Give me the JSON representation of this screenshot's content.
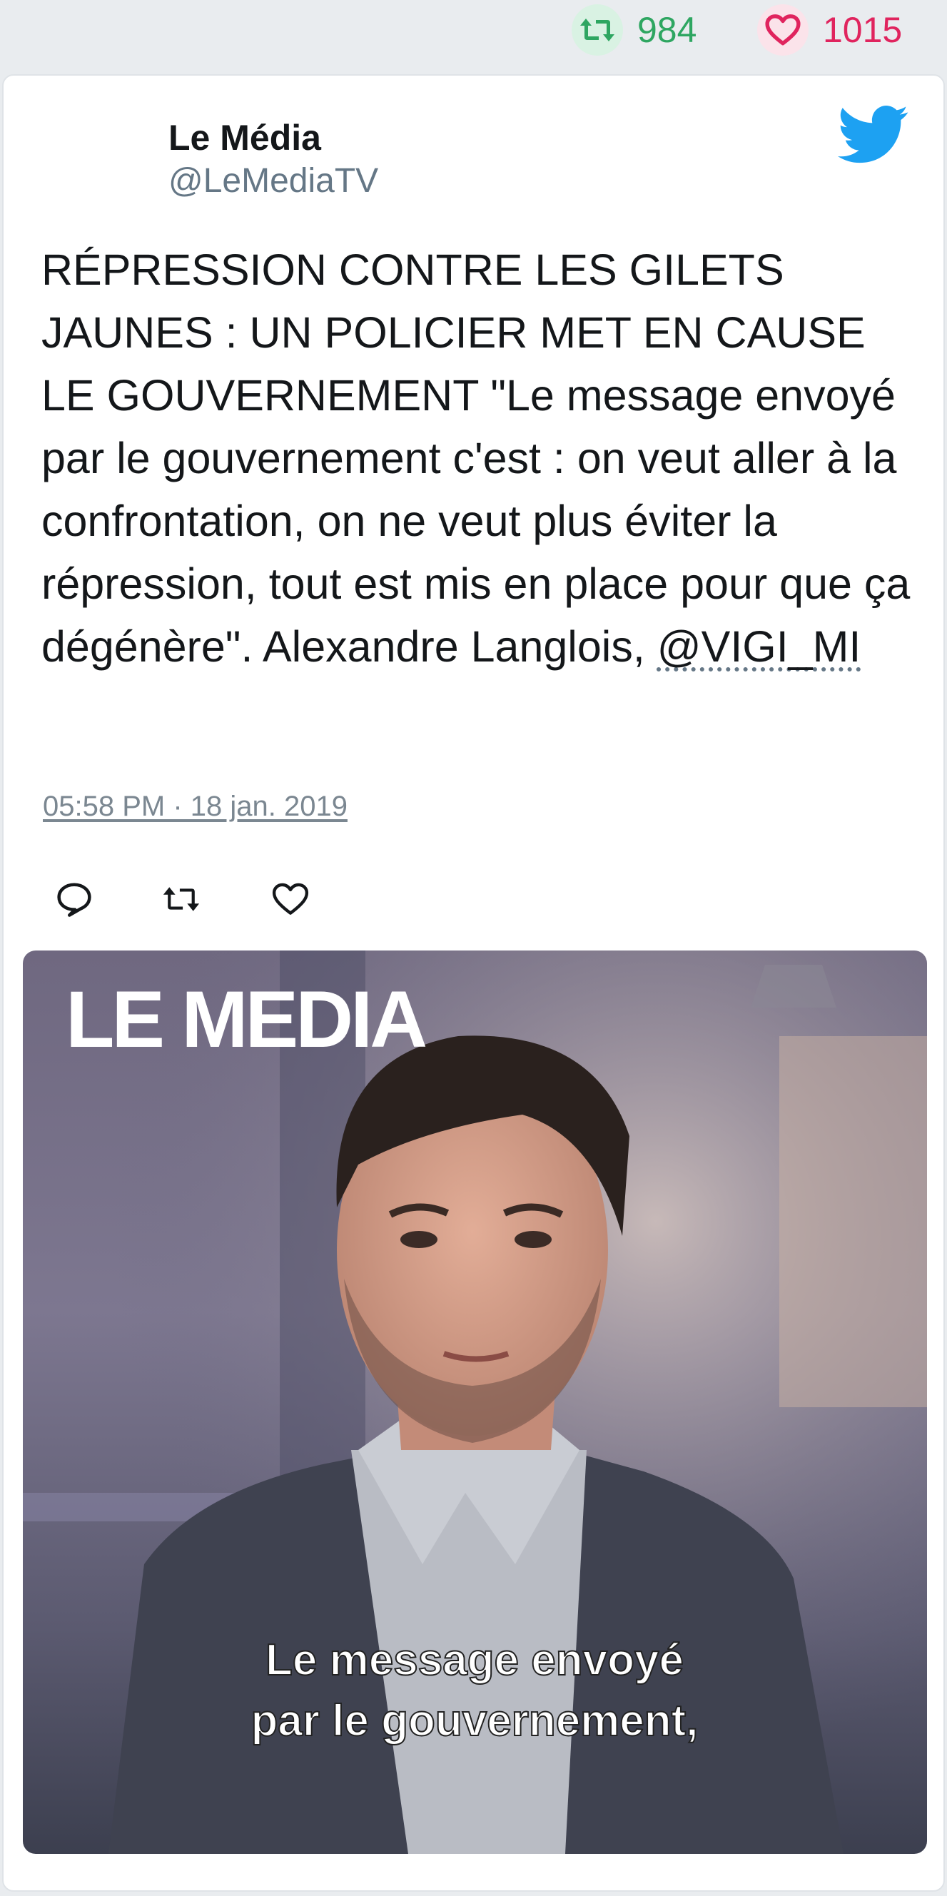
{
  "stats": {
    "retweets": "984",
    "likes": "1015"
  },
  "tweet": {
    "author_name": "Le Média",
    "author_handle": "@LeMediaTV",
    "text": "RÉPRESSION CONTRE LES GILETS JAUNES : UN POLICIER MET EN CAUSE LE GOUVERNEMENT \"Le message envoyé par le gouvernement c'est : on veut aller à la confrontation, on ne veut plus éviter la répression, tout est mis en place pour que ça dégénère\". Alexandre Langlois, ",
    "mention": "@VIGI_MI",
    "timestamp": "05:58 PM · 18 jan. 2019"
  },
  "media": {
    "logo_text": "LE MEDIA",
    "caption_line1": "Le message envoyé",
    "caption_line2": "par le gouvernement,"
  },
  "colors": {
    "retweet_green": "#2ea661",
    "like_pink": "#e0245e",
    "twitter_blue": "#1da1f2"
  },
  "icons": [
    "retweet-icon",
    "heart-icon",
    "twitter-bird-icon",
    "reply-icon",
    "retweet-action-icon",
    "like-action-icon"
  ]
}
